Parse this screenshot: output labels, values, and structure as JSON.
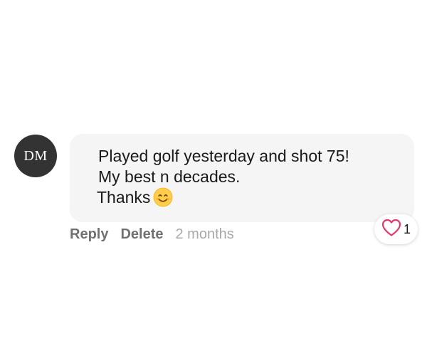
{
  "comment": {
    "author_initials": "DM",
    "text_lines": [
      "Played golf yesterday and shot 75!",
      "My best n decades.",
      "Thanks"
    ],
    "emoji_name": "smiling-face-icon"
  },
  "actions": {
    "reply_label": "Reply",
    "delete_label": "Delete",
    "timestamp": "2 months"
  },
  "reaction": {
    "icon": "heart-icon",
    "count": "1",
    "color": "#e8356d"
  },
  "colors": {
    "avatar_bg": "#333333",
    "bubble_bg": "#f5f5f5",
    "action_text": "#717171",
    "timestamp_text": "#a8a8a8"
  }
}
